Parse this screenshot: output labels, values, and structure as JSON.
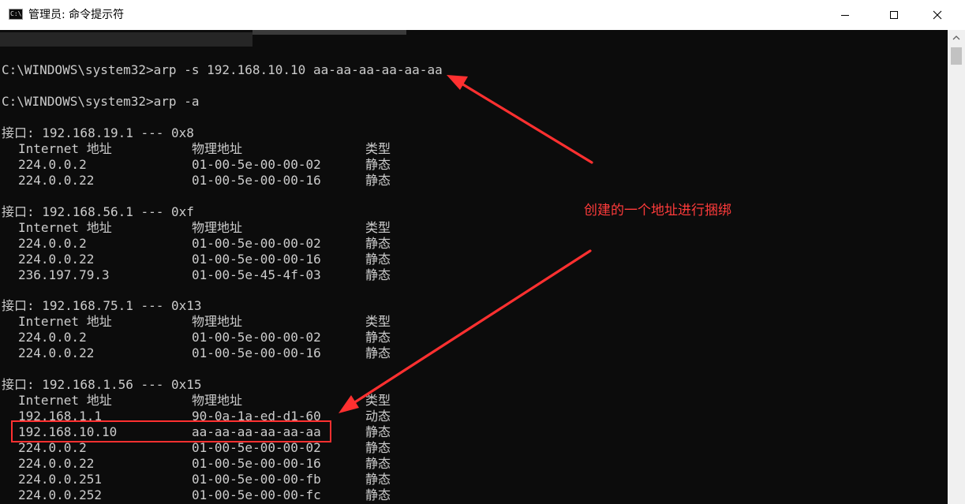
{
  "window": {
    "title": "管理员: 命令提示符",
    "icon": "console-icon",
    "icon_glyph": "C:\\"
  },
  "controls": {
    "minimize_icon": "minimize-icon",
    "maximize_icon": "maximize-icon",
    "close_icon": "close-icon"
  },
  "console": {
    "background": "#0c0c0c",
    "text_color": "#cccccc",
    "commands": [
      "C:\\WINDOWS\\system32>arp -s 192.168.10.10 aa-aa-aa-aa-aa-aa",
      "C:\\WINDOWS\\system32>arp -a"
    ],
    "header": {
      "address": "Internet 地址",
      "mac": "物理地址",
      "type": "类型"
    },
    "interfaces": [
      {
        "line": "接口: 192.168.19.1 --- 0x8",
        "rows": [
          {
            "address": "224.0.0.2",
            "mac": "01-00-5e-00-00-02",
            "type": "静态"
          },
          {
            "address": "224.0.0.22",
            "mac": "01-00-5e-00-00-16",
            "type": "静态"
          }
        ]
      },
      {
        "line": "接口: 192.168.56.1 --- 0xf",
        "rows": [
          {
            "address": "224.0.0.2",
            "mac": "01-00-5e-00-00-02",
            "type": "静态"
          },
          {
            "address": "224.0.0.22",
            "mac": "01-00-5e-00-00-16",
            "type": "静态"
          },
          {
            "address": "236.197.79.3",
            "mac": "01-00-5e-45-4f-03",
            "type": "静态"
          }
        ]
      },
      {
        "line": "接口: 192.168.75.1 --- 0x13",
        "rows": [
          {
            "address": "224.0.0.2",
            "mac": "01-00-5e-00-00-02",
            "type": "静态"
          },
          {
            "address": "224.0.0.22",
            "mac": "01-00-5e-00-00-16",
            "type": "静态"
          }
        ]
      },
      {
        "line": "接口: 192.168.1.56 --- 0x15",
        "rows": [
          {
            "address": "192.168.1.1",
            "mac": "90-0a-1a-ed-d1-60",
            "type": "动态"
          },
          {
            "address": "192.168.10.10",
            "mac": "aa-aa-aa-aa-aa-aa",
            "type": "静态"
          },
          {
            "address": "224.0.0.2",
            "mac": "01-00-5e-00-00-02",
            "type": "静态"
          },
          {
            "address": "224.0.0.22",
            "mac": "01-00-5e-00-00-16",
            "type": "静态"
          },
          {
            "address": "224.0.0.251",
            "mac": "01-00-5e-00-00-fb",
            "type": "静态"
          },
          {
            "address": "224.0.0.252",
            "mac": "01-00-5e-00-00-fc",
            "type": "静态"
          }
        ]
      }
    ]
  },
  "annotation": {
    "text": "创建的一个地址进行捆绑",
    "color": "#ff3b3b"
  }
}
